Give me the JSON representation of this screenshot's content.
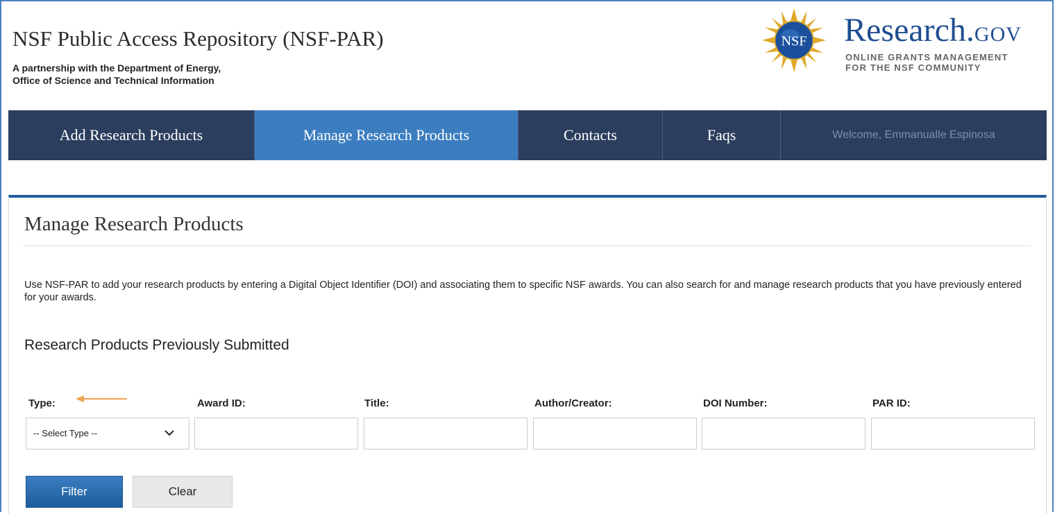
{
  "header": {
    "title": "NSF Public Access Repository (NSF-PAR)",
    "tagline_line1": "A partnership with the Department of Energy,",
    "tagline_line2": "Office of Science and Technical Information",
    "logo": {
      "seal_text": "NSF",
      "brand_main": "Research.",
      "brand_suffix": "GOV",
      "sub_line1": "ONLINE GRANTS MANAGEMENT",
      "sub_line2": "FOR THE NSF COMMUNITY"
    }
  },
  "nav": {
    "items": [
      {
        "label": "Add Research Products",
        "active": false
      },
      {
        "label": "Manage Research Products",
        "active": true
      },
      {
        "label": "Contacts",
        "active": false
      },
      {
        "label": "Faqs",
        "active": false
      }
    ],
    "welcome": "Welcome, Emmanualle Espinosa"
  },
  "main": {
    "title": "Manage Research Products",
    "description": "Use NSF-PAR to add your research products by entering a Digital Object Identifier (DOI) and associating them to specific NSF awards. You can also search for and manage research products that you have previously entered for your awards.",
    "section_title": "Research Products Previously Submitted",
    "filters": {
      "type_label": "Type:",
      "type_value": "-- Select Type --",
      "award_label": "Award ID:",
      "title_label": "Title:",
      "author_label": "Author/Creator:",
      "doi_label": "DOI Number:",
      "par_label": "PAR ID:"
    },
    "buttons": {
      "filter": "Filter",
      "clear": "Clear"
    }
  },
  "colors": {
    "nav_bg": "#2b3e5e",
    "nav_active": "#3c7dc0",
    "accent": "#1f5d9e",
    "annotation_arrow": "#f0a050"
  }
}
